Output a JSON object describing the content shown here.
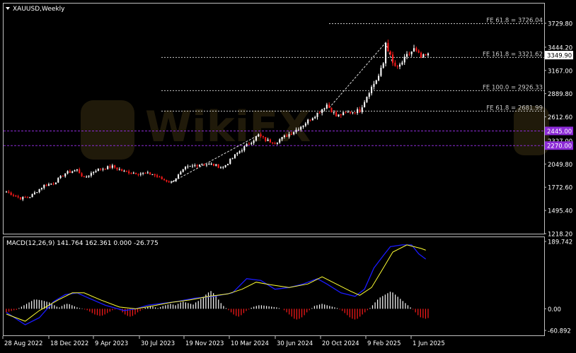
{
  "window": {
    "symbol_title": "XAUUSD,Weekly",
    "watermark_text": "WikiFX"
  },
  "colors": {
    "background": "#000000",
    "frame": "#c0c0c0",
    "bull": "#ffffff",
    "bear": "#ff1a1a",
    "fe_line": "#c8c8c8",
    "level_line": "#8c2bd6",
    "level_label_bg": "#8c2bd6",
    "macd_line": "#1a1aff",
    "signal_line": "#ffff33",
    "hist_pos": "#ffffff",
    "hist_neg": "#ff1a1a",
    "price_tag_bg": "#ffffff",
    "price_tag_text": "#000000"
  },
  "chart_data": [
    {
      "type": "candlestick",
      "title": "XAUUSD,Weekly",
      "timeframe": "Weekly",
      "ylim": [
        1218.2,
        3828.0
      ],
      "price_axis_ticks": [
        "3729.80",
        "3444.20",
        "3167.00",
        "2889.80",
        "2612.60",
        "2049.80",
        "1772.60",
        "1495.40",
        "1218.20"
      ],
      "hidden_tick": "2327.00",
      "time_axis_labels": [
        "28 Aug 2022",
        "18 Dec 2022",
        "9 Apr 2023",
        "30 Jul 2023",
        "19 Nov 2023",
        "10 Mar 2024",
        "30 Jun 2024",
        "20 Oct 2024",
        "9 Feb 2025",
        "1 Jun 2025"
      ],
      "current_price": "3349.90",
      "price_path": [
        [
          0,
          1720
        ],
        [
          6,
          1640
        ],
        [
          10,
          1660
        ],
        [
          16,
          1795
        ],
        [
          20,
          1820
        ],
        [
          25,
          1940
        ],
        [
          30,
          1980
        ],
        [
          33,
          1880
        ],
        [
          38,
          1980
        ],
        [
          45,
          2020
        ],
        [
          50,
          1960
        ],
        [
          56,
          1940
        ],
        [
          62,
          1930
        ],
        [
          66,
          1870
        ],
        [
          70,
          1830
        ],
        [
          76,
          2000
        ],
        [
          82,
          2050
        ],
        [
          87,
          2045
        ],
        [
          92,
          2010
        ],
        [
          98,
          2180
        ],
        [
          104,
          2320
        ],
        [
          107,
          2395
        ],
        [
          110,
          2335
        ],
        [
          114,
          2310
        ],
        [
          122,
          2440
        ],
        [
          126,
          2520
        ],
        [
          133,
          2680
        ],
        [
          136,
          2760
        ],
        [
          140,
          2620
        ],
        [
          144,
          2660
        ],
        [
          150,
          2690
        ],
        [
          154,
          2920
        ],
        [
          158,
          3100
        ],
        [
          160,
          3250
        ],
        [
          161,
          3500
        ],
        [
          164,
          3250
        ],
        [
          166,
          3190
        ],
        [
          170,
          3340
        ],
        [
          173,
          3420
        ],
        [
          176,
          3320
        ],
        [
          179,
          3350
        ]
      ],
      "fibonacci_extensions": [
        {
          "label": "FE 61.8 = 3726.04",
          "value": 3726.04
        },
        {
          "label": "FE 161.8 = 3321.62",
          "value": 3321.62
        },
        {
          "label": "FE 100.0 = 2926.33",
          "value": 2926.33
        },
        {
          "label": "FE 61.8 = 2681.99",
          "value": 2681.99
        }
      ],
      "horizontal_levels": [
        {
          "label": "2445.00",
          "value": 2445.0
        },
        {
          "label": "2270.00",
          "value": 2270.0
        }
      ],
      "trend_lines": [
        {
          "from": [
            70,
            1830
          ],
          "to": [
            107,
            2395
          ]
        },
        {
          "from": [
            137,
            2720
          ],
          "to": [
            161,
            3500
          ]
        },
        {
          "from": [
            161,
            3500
          ],
          "to": [
            164,
            3250
          ]
        }
      ]
    },
    {
      "type": "line",
      "indicator": "MACD",
      "title": "MACD(12,26,9) 141.764 162.361 0.000 -26.775",
      "ylim": [
        -80.0,
        200.0
      ],
      "axis_ticks": [
        "189.742",
        "0.00",
        "-60.892"
      ],
      "macd_path": [
        [
          0,
          -10
        ],
        [
          8,
          -45
        ],
        [
          14,
          -25
        ],
        [
          20,
          20
        ],
        [
          25,
          40
        ],
        [
          30,
          45
        ],
        [
          35,
          30
        ],
        [
          42,
          10
        ],
        [
          50,
          -5
        ],
        [
          55,
          0
        ],
        [
          60,
          10
        ],
        [
          66,
          15
        ],
        [
          72,
          20
        ],
        [
          80,
          30
        ],
        [
          88,
          35
        ],
        [
          96,
          45
        ],
        [
          102,
          85
        ],
        [
          108,
          80
        ],
        [
          114,
          55
        ],
        [
          120,
          60
        ],
        [
          126,
          70
        ],
        [
          132,
          85
        ],
        [
          136,
          70
        ],
        [
          142,
          45
        ],
        [
          148,
          35
        ],
        [
          152,
          55
        ],
        [
          156,
          115
        ],
        [
          160,
          150
        ],
        [
          163,
          175
        ],
        [
          168,
          180
        ],
        [
          172,
          180
        ],
        [
          175,
          155
        ],
        [
          178,
          140
        ]
      ],
      "signal_path": [
        [
          0,
          -15
        ],
        [
          8,
          -35
        ],
        [
          14,
          -5
        ],
        [
          22,
          25
        ],
        [
          28,
          45
        ],
        [
          33,
          45
        ],
        [
          40,
          25
        ],
        [
          48,
          5
        ],
        [
          55,
          0
        ],
        [
          62,
          8
        ],
        [
          70,
          18
        ],
        [
          78,
          25
        ],
        [
          86,
          35
        ],
        [
          94,
          42
        ],
        [
          100,
          55
        ],
        [
          106,
          75
        ],
        [
          112,
          68
        ],
        [
          120,
          60
        ],
        [
          128,
          70
        ],
        [
          134,
          90
        ],
        [
          140,
          70
        ],
        [
          146,
          50
        ],
        [
          150,
          38
        ],
        [
          155,
          60
        ],
        [
          160,
          115
        ],
        [
          164,
          160
        ],
        [
          170,
          180
        ],
        [
          176,
          170
        ],
        [
          178,
          165
        ]
      ],
      "histogram": [
        -10,
        -8,
        -6,
        -4,
        -3,
        2,
        6,
        10,
        14,
        18,
        22,
        26,
        26,
        25,
        24,
        22,
        20,
        18,
        14,
        10,
        6,
        4,
        8,
        12,
        14,
        13,
        10,
        7,
        4,
        2,
        1,
        -2,
        -4,
        -8,
        -12,
        -16,
        -18,
        -20,
        -19,
        -16,
        -12,
        -8,
        -4,
        -2,
        -1,
        -4,
        -10,
        -16,
        -20,
        -22,
        -20,
        -16,
        -10,
        -6,
        -2,
        3,
        5,
        8,
        6,
        4,
        2,
        5,
        8,
        10,
        12,
        14,
        12,
        10,
        14,
        18,
        20,
        18,
        16,
        14,
        12,
        18,
        22,
        28,
        34,
        40,
        46,
        50,
        44,
        36,
        26,
        16,
        8,
        2,
        -4,
        -10,
        -16,
        -20,
        -22,
        -18,
        -12,
        -6,
        -2,
        3,
        6,
        8,
        10,
        10,
        9,
        8,
        7,
        6,
        5,
        4,
        2,
        0,
        -4,
        -10,
        -16,
        -22,
        -28,
        -30,
        -28,
        -24,
        -18,
        -10,
        -4,
        2,
        8,
        10,
        12,
        14,
        12,
        10,
        8,
        6,
        4,
        2,
        -2,
        -6,
        -12,
        -18,
        -24,
        -28,
        -30,
        -28,
        -22,
        -16,
        -10,
        -4,
        2,
        10,
        18,
        26,
        32,
        36,
        40,
        44,
        48,
        46,
        40,
        34,
        28,
        22,
        16,
        10,
        4,
        -2,
        -10,
        -18,
        -24,
        -26,
        -28,
        -26
      ]
    }
  ]
}
